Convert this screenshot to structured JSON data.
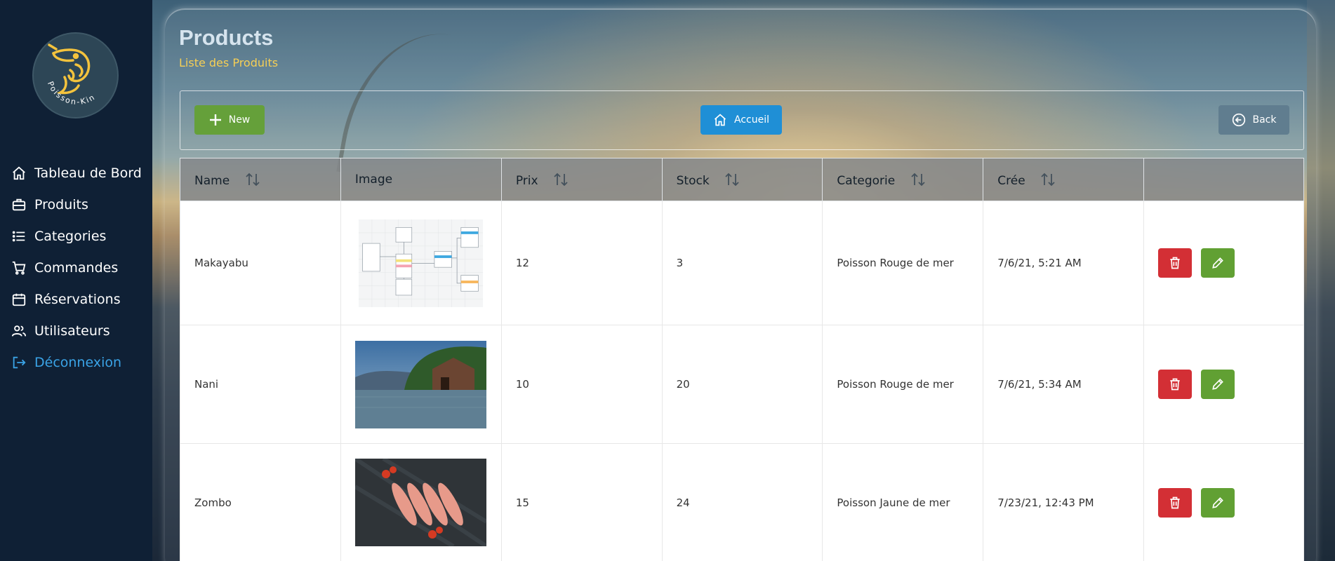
{
  "sidebar": {
    "logo_text": "Poisson-Kin",
    "items": [
      {
        "label": "Tableau de Bord",
        "icon": "home-icon"
      },
      {
        "label": "Produits",
        "icon": "briefcase-icon"
      },
      {
        "label": "Categories",
        "icon": "list-icon"
      },
      {
        "label": "Commandes",
        "icon": "cart-icon"
      },
      {
        "label": "Réservations",
        "icon": "calendar-icon"
      },
      {
        "label": "Utilisateurs",
        "icon": "users-icon"
      },
      {
        "label": "Déconnexion",
        "icon": "logout-icon"
      }
    ]
  },
  "header": {
    "title": "Products",
    "subtitle": "Liste des Produits"
  },
  "toolbar": {
    "new_label": "New",
    "home_label": "Accueil",
    "back_label": "Back"
  },
  "table": {
    "columns": [
      "Name",
      "Image",
      "Prix",
      "Stock",
      "Categorie",
      "Crée",
      ""
    ],
    "rows": [
      {
        "name": "Makayabu",
        "image": "diagram-thumbnail",
        "prix": "12",
        "stock": "3",
        "categorie": "Poisson Rouge de mer",
        "cree": "7/6/21, 5:21 AM"
      },
      {
        "name": "Nani",
        "image": "lake-house-photo",
        "prix": "10",
        "stock": "20",
        "categorie": "Poisson Rouge de mer",
        "cree": "7/6/21, 5:34 AM"
      },
      {
        "name": "Zombo",
        "image": "red-fish-photo",
        "prix": "15",
        "stock": "24",
        "categorie": "Poisson Jaune de mer",
        "cree": "7/23/21, 12:43 PM"
      }
    ]
  },
  "colors": {
    "sidebar_bg": "#0f2035",
    "accent_yellow": "#f6cf55",
    "new_button": "#65a03a",
    "home_button": "#1f8fd6",
    "back_button": "#607d8f",
    "delete_button": "#d32f35",
    "edit_button": "#61a033",
    "logout_link": "#3aa3e6"
  }
}
